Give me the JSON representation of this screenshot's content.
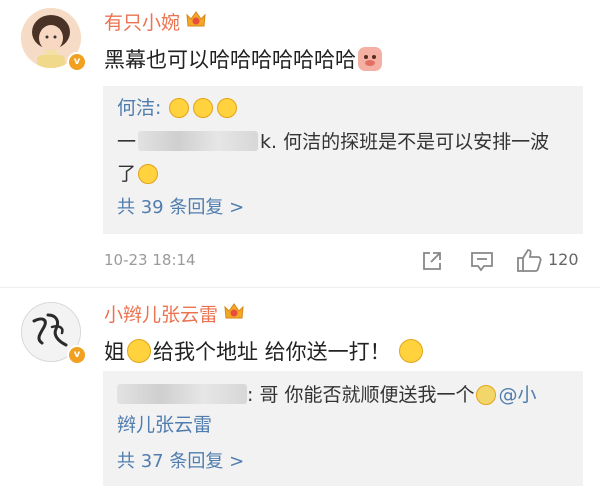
{
  "comments": [
    {
      "username": "有只小婉",
      "text": "黑幕也可以哈哈哈哈哈哈哈",
      "reply": {
        "author": "何洁:",
        "line1_prefix": "一",
        "line1_suffix": "k. 何洁的探班是不是可以安排一波",
        "line2": "了",
        "more": "共 39 条回复 >"
      },
      "time": "10-23 18:14",
      "like_count": "120"
    },
    {
      "username": "小辫儿张云雷",
      "text_part1": "姐",
      "text_part2": "给我个地址 给你送一打！",
      "reply": {
        "line1": ": 哥 你能否就顺便送我一个",
        "mention_start": "@小",
        "line2": "辫儿张云雷",
        "more": "共 37 条回复 >"
      }
    }
  ],
  "icons": {
    "share": "share-icon",
    "comment": "comment-icon",
    "like": "thumbs-up-icon",
    "crown": "crown-badge-icon",
    "verified": "verified-v-badge-icon"
  },
  "colors": {
    "username": "#eb7350",
    "link": "#507daf",
    "reply_bg": "#f2f2f2",
    "verified_badge": "#f2a01f",
    "timestamp": "#9a9a9a"
  }
}
